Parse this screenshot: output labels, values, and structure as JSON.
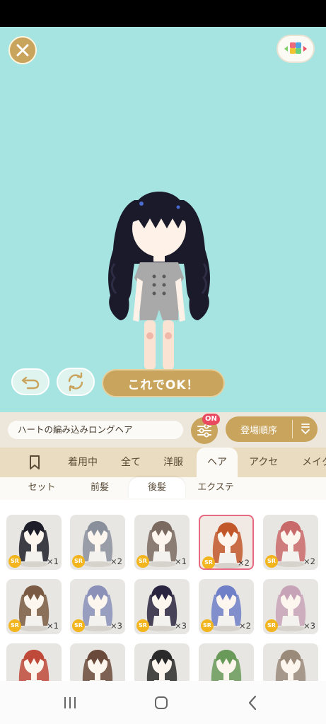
{
  "stage": {
    "bg_color": "#a6e4e2",
    "close_icon": "close-icon",
    "bg_select_icon": "color-blocks-icon",
    "undo_icon": "undo-icon",
    "rotate_icon": "refresh-icon",
    "ok_label": "これでOK！"
  },
  "info": {
    "item_name": "ハートの編み込みロングヘア",
    "filter_badge": "ON",
    "sort_label": "登場順序"
  },
  "tabs": {
    "items": [
      "着用中",
      "全て",
      "洋服",
      "ヘア",
      "アクセ",
      "メイク"
    ],
    "active": "ヘア"
  },
  "subtabs": {
    "items": [
      "セット",
      "前髪",
      "後髪",
      "エクステ"
    ],
    "active": "後髪"
  },
  "grid": {
    "rarity_label": "SR",
    "items": [
      {
        "qty": "×1",
        "hair": "#1e1e2a"
      },
      {
        "qty": "×2",
        "hair": "#8a8f9c"
      },
      {
        "qty": "×1",
        "hair": "#7a6a60"
      },
      {
        "qty": "×2",
        "hair": "#c2572a",
        "selected": true
      },
      {
        "qty": "×2",
        "hair": "#c96a6a"
      },
      {
        "qty": "×1",
        "hair": "#7a5a42"
      },
      {
        "qty": "×3",
        "hair": "#8a90b8"
      },
      {
        "qty": "×3",
        "hair": "#2a2440"
      },
      {
        "qty": "×2",
        "hair": "#6f7fc8"
      },
      {
        "qty": "×3",
        "hair": "#c7a3b8"
      },
      {
        "qty": "",
        "hair": "#c04a3a"
      },
      {
        "qty": "",
        "hair": "#6a4a3a"
      },
      {
        "qty": "",
        "hair": "#2a2a2a"
      },
      {
        "qty": "",
        "hair": "#6a9a5a"
      },
      {
        "qty": "",
        "hair": "#9a8a7a"
      }
    ]
  }
}
